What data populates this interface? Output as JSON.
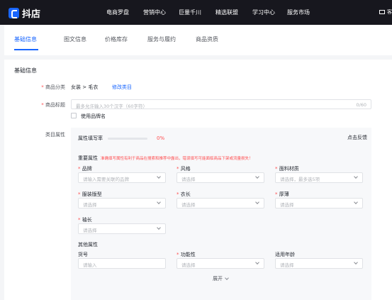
{
  "app": {
    "logo_text": "抖店"
  },
  "topnav": [
    "电商罗盘",
    "营销中心",
    "巨量千川",
    "精选联盟",
    "学习中心",
    "服务市场"
  ],
  "top_right_label": "客",
  "tabs": [
    "基础信息",
    "图文信息",
    "价格库存",
    "服务与履约",
    "商品资质"
  ],
  "active_tab": "基础信息",
  "section_title": "基础信息",
  "category": {
    "label": "商品分类",
    "value": "女装 > 毛衣",
    "link": "修改类目"
  },
  "product_title": {
    "label": "商品标题",
    "placeholder": "最多允许输入30个汉字（60字符）",
    "counter": "0/60"
  },
  "brand_checkbox": {
    "label": "使用品牌名",
    "checked": false
  },
  "attributes": {
    "label": "类目属性",
    "fill_rate_label": "属性填写率",
    "fill_rate": "0%",
    "fill_rate_value": 0,
    "feedback": "点击反馈",
    "important_title": "重要属性",
    "important_hint": "准确填写属性有利于商品在搜索和推荐中露出，错误填写可能面临商品下架或流量损失！",
    "important_fields": [
      {
        "label": "品牌",
        "required": true,
        "placeholder": "请输入需要关联的品牌"
      },
      {
        "label": "风格",
        "required": true,
        "placeholder": "请选择"
      },
      {
        "label": "面料材质",
        "required": true,
        "placeholder": "请选择，最多选5项"
      },
      {
        "label": "服装版型",
        "required": true,
        "placeholder": "请选择"
      },
      {
        "label": "衣长",
        "required": true,
        "placeholder": "请选择"
      },
      {
        "label": "厚薄",
        "required": true,
        "placeholder": "请选择"
      },
      {
        "label": "袖长",
        "required": true,
        "placeholder": "请选择"
      }
    ],
    "other_title": "其他属性",
    "other_fields": [
      {
        "label": "货号",
        "required": false,
        "placeholder": "请输入"
      },
      {
        "label": "功能性",
        "required": true,
        "placeholder": "请选择"
      },
      {
        "label": "适用年龄",
        "required": false,
        "placeholder": "请选择"
      }
    ],
    "expand_label": "展开"
  }
}
